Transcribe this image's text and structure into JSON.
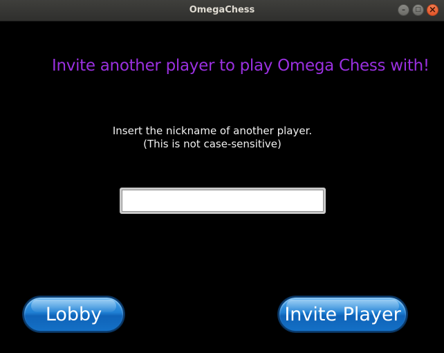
{
  "window": {
    "title": "OmegaChess",
    "controls": {
      "minimize_icon": "–",
      "maximize_icon": "□",
      "close_icon": "×"
    }
  },
  "invite": {
    "heading": "Invite another player to play Omega Chess with!",
    "instruction_line1": "Insert the nickname of another player.",
    "instruction_line2": "(This is not case-sensitive)",
    "nickname_value": ""
  },
  "buttons": {
    "lobby_label": "Lobby",
    "invite_label": "Invite Player"
  },
  "colors": {
    "heading": "#9a30e0",
    "background": "#000000",
    "button_blue": "#1f7fd3",
    "close_button": "#e3562a"
  }
}
